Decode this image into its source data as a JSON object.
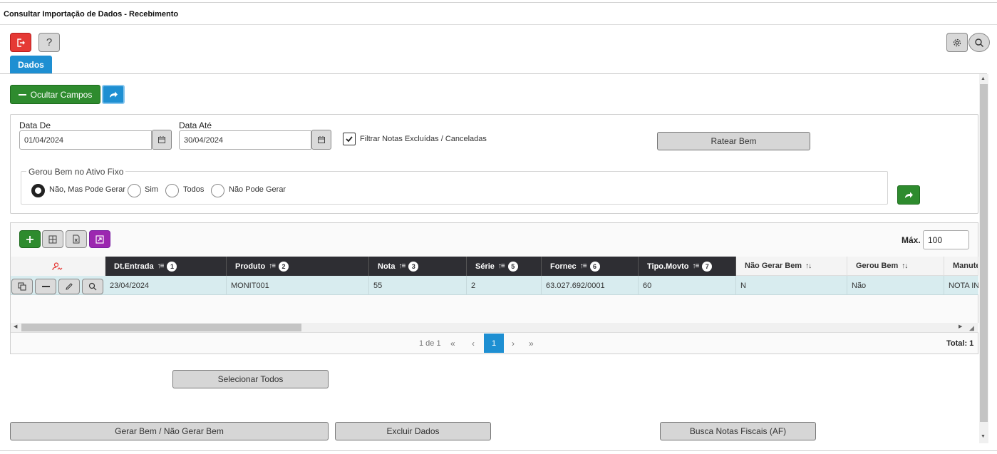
{
  "page_title": "Consultar Importação de Dados - Recebimento",
  "tabs": [
    {
      "label": "Dados"
    }
  ],
  "toolbar": {
    "ocultar_label": "Ocultar Campos"
  },
  "filters": {
    "data_de_label": "Data De",
    "data_de_value": "01/04/2024",
    "data_ate_label": "Data Até",
    "data_ate_value": "30/04/2024",
    "filtrar_label": "Filtrar Notas Excluídas / Canceladas",
    "filtrar_checked": true,
    "ratear_label": "Ratear Bem",
    "gerou_legend": "Gerou Bem no Ativo Fixo",
    "radio_options": [
      "Não, Mas Pode Gerar",
      "Sim",
      "Todos",
      "Não Pode Gerar"
    ],
    "radio_selected": "Não, Mas Pode Gerar"
  },
  "grid": {
    "max_label": "Máx.",
    "max_value": "100",
    "columns": [
      {
        "label": "Dt.Entrada",
        "order": "1"
      },
      {
        "label": "Produto",
        "order": "2"
      },
      {
        "label": "Nota",
        "order": "3"
      },
      {
        "label": "Série",
        "order": "5"
      },
      {
        "label": "Fornec",
        "order": "6"
      },
      {
        "label": "Tipo.Movto",
        "order": "7"
      },
      {
        "label": "Não Gerar Bem",
        "order": ""
      },
      {
        "label": "Gerou Bem",
        "order": ""
      },
      {
        "label": "Manute",
        "order": ""
      }
    ],
    "rows": [
      [
        "23/04/2024",
        "MONIT001",
        "55",
        "2",
        "63.027.692/0001",
        "60",
        "N",
        "Não",
        "NOTA INC"
      ]
    ],
    "pager": {
      "info": "1 de 1",
      "current": "1",
      "total_label": "Total: 1"
    }
  },
  "actions": {
    "selecionar_todos": "Selecionar Todos",
    "gerar_bem": "Gerar Bem / Não Gerar Bem",
    "excluir_dados": "Excluir Dados",
    "busca_notas": "Busca Notas Fiscais (AF)"
  },
  "colors": {
    "accent_blue": "#1e8fd2",
    "green": "#2e8b2e",
    "red": "#e53935",
    "purple": "#9c27b0",
    "header_dark": "#2e2e33",
    "row_highlight": "#d8ecef"
  }
}
